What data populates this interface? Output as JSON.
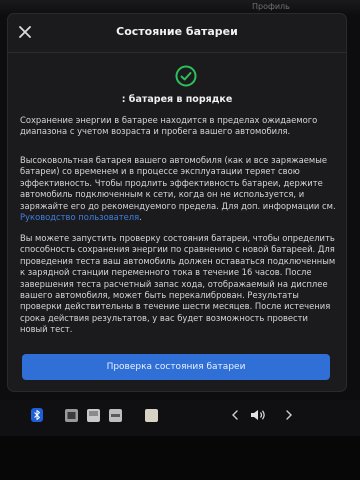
{
  "background": {
    "profile_hint": "Профиль"
  },
  "modal": {
    "title": "Состояние батареи",
    "status_text": ": батарея в порядке",
    "paragraph1": "Сохранение энергии в батарее находится в пределах ожидаемого диапазона с учетом возраста и пробега вашего автомобиля.",
    "paragraph2": "Высоковольтная батарея вашего автомобиля (как и все заряжаемые батареи) со временем и в процессе эксплуатации теряет свою эффективность. Чтобы продлить эффективность батареи, держите автомобиль подключенным к сети, когда он не используется, и заряжайте его до рекомендуемого предела. Для доп. информации см.",
    "paragraph2_link": "Руководство пользователя",
    "paragraph2_end": ".",
    "paragraph3": "Вы можете запустить проверку состояния батареи, чтобы определить способность сохранения энергии по сравнению с новой батареей. Для проведения теста ваш автомобиль должен оставаться подключенным к зарядной станции переменного тока в течение 16 часов. После завершения теста расчетный запас хода, отображаемый на дисплее вашего автомобиля, может быть перекалиброван. Результаты проверки действительны в течение шести месяцев. После истечения срока действия результатов, у вас будет возможность провести новый тест.",
    "button_label": "Проверка состояния батареи"
  },
  "colors": {
    "accent": "#2f6fd6",
    "link": "#3e7fe0",
    "status_ok": "#2fbf5a",
    "modal_bg": "#1b1b1e"
  },
  "taskbar": {
    "icons": [
      "bluetooth-icon",
      "media-icon",
      "app-icon",
      "app-icon",
      "app-icon",
      "chevron-left-icon",
      "volume-icon",
      "chevron-right-icon"
    ]
  }
}
